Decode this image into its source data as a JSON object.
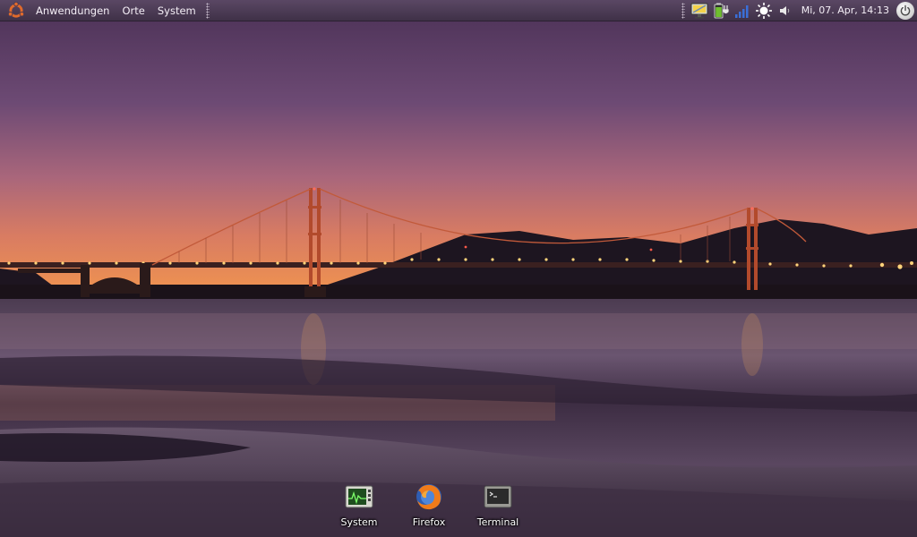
{
  "top_panel": {
    "menus": [
      {
        "label": "Anwendungen"
      },
      {
        "label": "Orte"
      },
      {
        "label": "System"
      }
    ],
    "tray_icons": [
      "display-icon",
      "battery-icon",
      "wireless-signal-icon",
      "brightness-icon",
      "volume-icon"
    ],
    "clock": "Mi, 07. Apr, 14:13"
  },
  "desktop": {
    "icons": [
      {
        "label": "System",
        "icon": "system-monitor-icon"
      },
      {
        "label": "Firefox",
        "icon": "firefox-icon"
      },
      {
        "label": "Terminal",
        "icon": "terminal-icon"
      }
    ]
  },
  "colors": {
    "panel": "#4a3a53",
    "sky_top": "#4a3156",
    "sky_horizon": "#e9885a",
    "water": "#3a2a3e"
  }
}
